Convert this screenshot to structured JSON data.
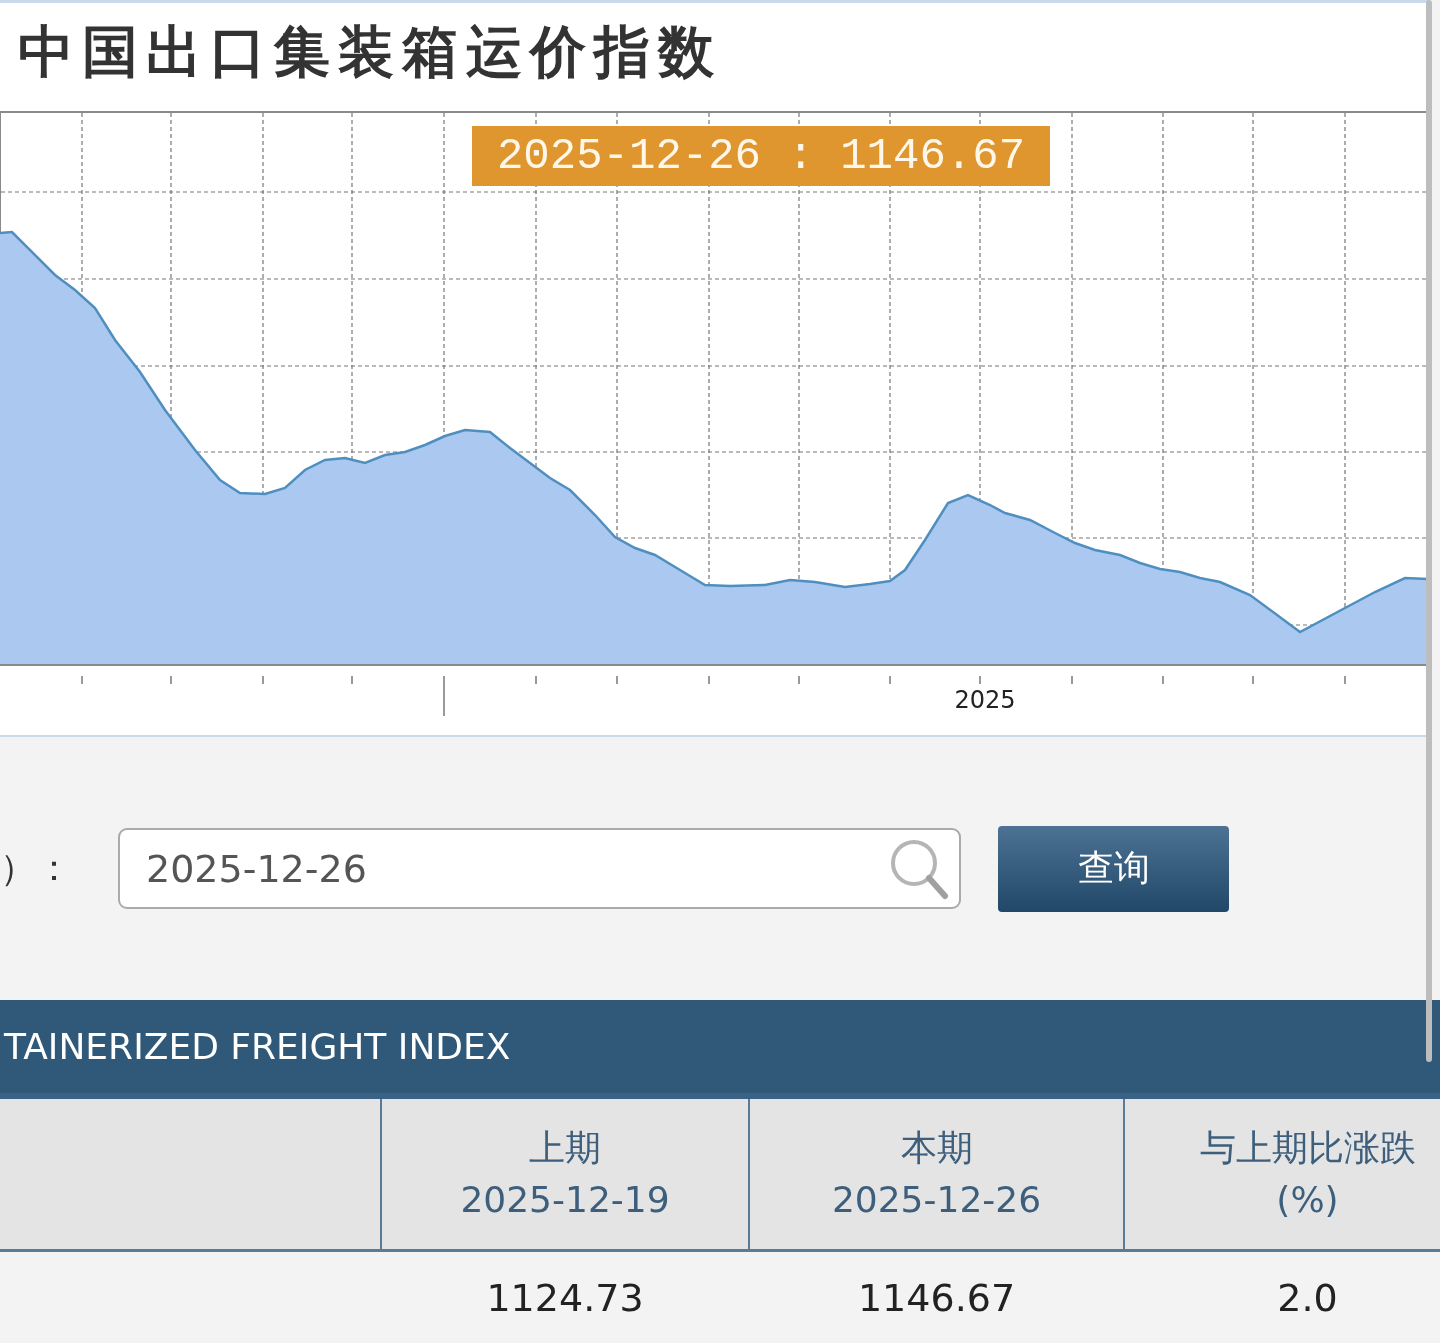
{
  "title": "中国出口集装箱运价指数",
  "chart": {
    "tooltip": "2025-12-26 : 1146.67",
    "axis_label": "2025"
  },
  "query": {
    "label": "）：",
    "date_value": "2025-12-26",
    "button": "查询"
  },
  "table": {
    "banner": "TAINERIZED FREIGHT INDEX",
    "columns": [
      {
        "lines": [
          "上期",
          "2025-12-19"
        ]
      },
      {
        "lines": [
          "本期",
          "2025-12-26"
        ]
      },
      {
        "lines": [
          "与上期比涨跌",
          "(%)"
        ]
      }
    ],
    "rows": [
      {
        "cells": [
          "1124.73",
          "1146.67",
          "2.0"
        ]
      }
    ]
  }
}
